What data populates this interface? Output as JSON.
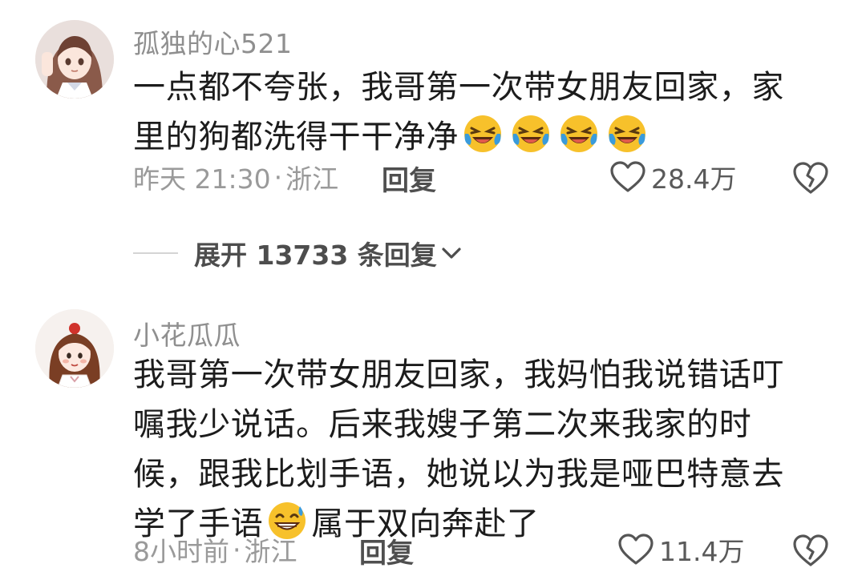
{
  "comments": [
    {
      "username": "孤独的心521",
      "avatar": "anime-girl-avatar",
      "lines": [
        "一点都不夸张，我哥第一次带女朋友回家，家",
        "里的狗都洗得干干净净"
      ],
      "trailing_emojis": [
        "laughing-crying-emoji",
        "laughing-crying-emoji",
        "laughing-crying-emoji",
        "laughing-crying-emoji"
      ],
      "time": "昨天 21:30",
      "location": "浙江",
      "reply_label": "回复",
      "likes": "28.4万"
    },
    {
      "username": "小花瓜瓜",
      "avatar": "cartoon-girl-avatar",
      "lines": [
        "我哥第一次带女朋友回家，我妈怕我说错话叮",
        "嘱我少说话。后来我嫂子第二次来我家的时",
        "候，跟我比划手语，她说以为我是哑巴特意去"
      ],
      "last_line_before": "学了手语",
      "last_line_emoji": "sweat-grin-emoji",
      "last_line_after": "属于双向奔赴了",
      "time": "8小时前",
      "location": "浙江",
      "reply_label": "回复",
      "likes": "11.4万"
    }
  ],
  "expand_replies": {
    "label": "展开 13733 条回复"
  },
  "meta_separator": "·",
  "colors": {
    "text": "#1c1c1c",
    "muted": "#9a9a9a",
    "username": "#8f8f8f",
    "emoji_yellow": "#f7c12b",
    "tear_blue": "#3a9bdc"
  }
}
